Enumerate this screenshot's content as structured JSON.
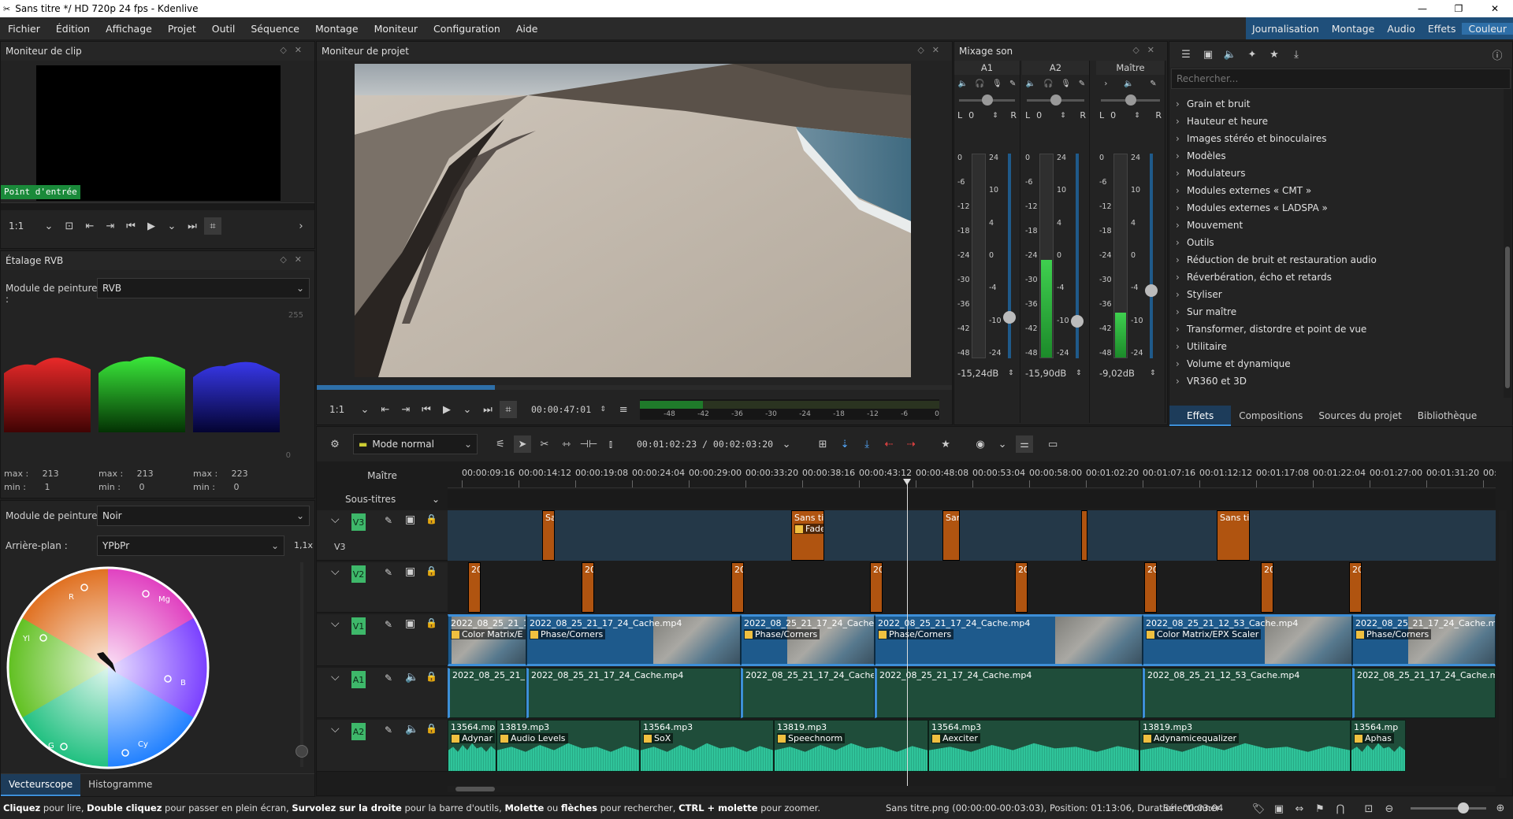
{
  "window": {
    "title": "Sans titre */ HD 720p 24 fps - Kdenlive"
  },
  "menu": [
    "Fichier",
    "Édition",
    "Affichage",
    "Projet",
    "Outil",
    "Séquence",
    "Montage",
    "Moniteur",
    "Configuration",
    "Aide"
  ],
  "workspaces": [
    "Journalisation",
    "Montage",
    "Audio",
    "Effets",
    "Couleur"
  ],
  "active_workspace": "Couleur",
  "clip_monitor": {
    "title": "Moniteur de clip",
    "in_point_label": "Point d'entrée",
    "zoom": "1:1"
  },
  "rgb_parade": {
    "title": "Étalage RVB",
    "paint_mode_label": "Module de peinture :",
    "paint_mode_value": "RVB",
    "scale_top": "255",
    "scale_bottom": "0",
    "channels": [
      {
        "max": "213",
        "min": "1"
      },
      {
        "max": "213",
        "min": "0"
      },
      {
        "max": "223",
        "min": "0"
      }
    ],
    "max_label": "max :",
    "min_label": "min :"
  },
  "vectorscope": {
    "paint_mode_label": "Module de peinture :",
    "paint_mode_value": "Noir",
    "background_label": "Arrière-plan :",
    "background_value": "YPbPr",
    "zoom": "1,1x",
    "labels": {
      "r": "R",
      "mg": "Mg",
      "yl": "Yl",
      "b": "B",
      "g": "G",
      "cy": "Cy"
    },
    "tabs": [
      "Vecteurscope",
      "Histogramme"
    ]
  },
  "project_monitor": {
    "title": "Moniteur de projet",
    "zoom": "1:1",
    "timecode": "00:00:47:01",
    "meter_ticks": [
      "-48",
      "-42",
      "-36",
      "-30",
      "-24",
      "-18",
      "-12",
      "-6",
      "0"
    ],
    "progress": 0.28
  },
  "mixer": {
    "title": "Mixage son",
    "channels": [
      {
        "name": "A1",
        "db": "-15,24dB",
        "pan_l": "L",
        "pan_val": "0",
        "pan_r": "R",
        "level": 0.0,
        "fader": 0.17
      },
      {
        "name": "A2",
        "db": "-15,90dB",
        "pan_l": "L",
        "pan_val": "0",
        "pan_r": "R",
        "level": 0.48,
        "fader": 0.15
      },
      {
        "name": "Maître",
        "db": "-9,02dB",
        "pan_l": "L",
        "pan_val": "0",
        "pan_r": "R",
        "level": 0.22,
        "fader": 0.3
      }
    ],
    "left_scale": [
      "0",
      "-6",
      "-12",
      "-18",
      "-24",
      "-30",
      "-36",
      "-42",
      "-48"
    ],
    "right_scale": [
      "24",
      "10",
      "4",
      "0",
      "-4",
      "-10",
      "-24"
    ]
  },
  "effects": {
    "search_placeholder": "Rechercher...",
    "items": [
      "Grain et bruit",
      "Hauteur et heure",
      "Images stéréo et binoculaires",
      "Modèles",
      "Modulateurs",
      "Modules externes « CMT »",
      "Modules externes « LADSPA »",
      "Mouvement",
      "Outils",
      "Réduction de bruit et restauration audio",
      "Réverbération, écho et retards",
      "Styliser",
      "Sur maître",
      "Transformer, distordre et point de vue",
      "Utilitaire",
      "Volume et dynamique",
      "VR360 et 3D"
    ],
    "tabs": [
      "Effets",
      "Compositions",
      "Sources du projet",
      "Bibliothèque"
    ],
    "active_tab": "Effets"
  },
  "timeline": {
    "mode": "Mode normal",
    "position": "00:01:02:23 / 00:02:03:20",
    "master_label": "Maître",
    "subtitles_label": "Sous-titres",
    "ruler": [
      "00:00:09:16",
      "00:00:14:12",
      "00:00:19:08",
      "00:00:24:04",
      "00:00:29:00",
      "00:00:33:20",
      "00:00:38:16",
      "00:00:43:12",
      "00:00:48:08",
      "00:00:53:04",
      "00:00:58:00",
      "00:01:02:20",
      "00:01:07:16",
      "00:01:12:12",
      "00:01:17:08",
      "00:01:22:04",
      "00:01:27:00",
      "00:01:31:20",
      "00:01:3"
    ],
    "tracks": [
      {
        "name": "V3",
        "sublabel": "V3"
      },
      {
        "name": "V2"
      },
      {
        "name": "V1"
      },
      {
        "name": "A1"
      },
      {
        "name": "A2"
      }
    ],
    "v3_clips": [
      {
        "name": "Sa"
      },
      {
        "name": "Sans titr",
        "effect": "Fade"
      },
      {
        "name": "Sans"
      },
      {
        "name": ""
      },
      {
        "name": "Sans titr"
      }
    ],
    "v2_clip_label": "20",
    "v2_clip_label_first": "20:",
    "v1_clips": [
      {
        "name": "2022_08_25_21_12",
        "effect": "Color Matrix/E"
      },
      {
        "name": "2022_08_25_21_17_24_Cache.mp4",
        "effect": "Phase/Corners"
      },
      {
        "name": "2022_08_25_21_17_24_Cache.mp",
        "effect": "Phase/Corners"
      },
      {
        "name": "2022_08_25_21_17_24_Cache.mp4",
        "effect": "Phase/Corners"
      },
      {
        "name": "2022_08_25_21_12_53_Cache.mp4",
        "effect": "Color Matrix/EPX Scaler"
      },
      {
        "name": "2022_08_25_21_17_24_Cache.mp4",
        "effect": "Phase/Corners"
      }
    ],
    "a1_clips": [
      {
        "name": "2022_08_25_21_12"
      },
      {
        "name": "2022_08_25_21_17_24_Cache.mp4"
      },
      {
        "name": "2022_08_25_21_17_24_Cache.mp"
      },
      {
        "name": "2022_08_25_21_17_24_Cache.mp4"
      },
      {
        "name": "2022_08_25_21_12_53_Cache.mp4"
      },
      {
        "name": "2022_08_25_21_17_24_Cache.mp4"
      }
    ],
    "a2_clips": [
      {
        "name": "13564.mp3",
        "effect": "Adynar"
      },
      {
        "name": "13819.mp3",
        "effect": "Audio Levels"
      },
      {
        "name": "13564.mp3",
        "effect": "SoX"
      },
      {
        "name": "13819.mp3",
        "effect": "Speechnorm"
      },
      {
        "name": "13564.mp3",
        "effect": "Aexciter"
      },
      {
        "name": "13819.mp3",
        "effect": "Adynamicequalizer"
      },
      {
        "name": "13564.mp",
        "effect": "Aphas"
      }
    ]
  },
  "status": {
    "hint_parts": [
      {
        "b": "Cliquez",
        "t": " pour lire, "
      },
      {
        "b": "Double cliquez",
        "t": " pour passer en plein écran, "
      },
      {
        "b": "Survolez sur la droite",
        "t": " pour la barre d'outils, "
      },
      {
        "b": "Molette",
        "t": " ou "
      },
      {
        "b": "flèches",
        "t": " pour rechercher, "
      },
      {
        "b": "CTRL + molette",
        "t": " pour zoomer."
      }
    ],
    "clip_info": "Sans titre.png (00:00:00-00:03:03), Position: 01:13:06, Duration: 00:03:04",
    "tool": "Sélectionner"
  },
  "colors": {
    "accent": "#2e6fa8",
    "video_clip": "#1e5a8c",
    "audio_clip_a1": "#1f4d3a",
    "audio_wave": "#2fc49a",
    "title_clip": "#c45a10",
    "track_badge": "#3eb86a"
  }
}
